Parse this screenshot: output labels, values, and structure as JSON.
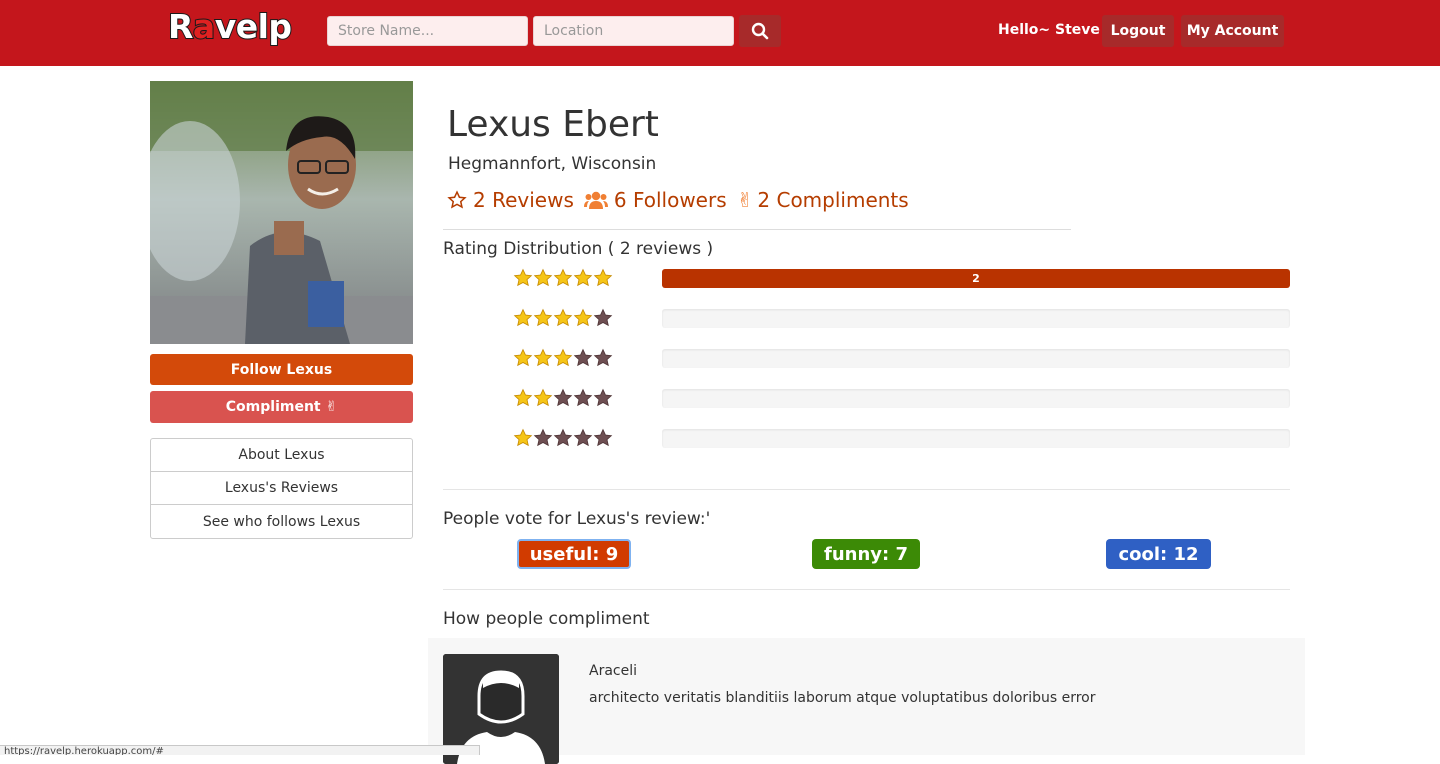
{
  "header": {
    "logo": "Ravelp",
    "store_placeholder": "Store Name...",
    "location_placeholder": "Location",
    "search_icon": "search-icon",
    "greeting": "Hello~ Steve",
    "logout_label": "Logout",
    "account_label": "My Account",
    "brand_color": "#c4161c"
  },
  "sidebar": {
    "follow_label": "Follow Lexus",
    "compliment_label": "Compliment ✌",
    "menu": [
      {
        "label": "About Lexus"
      },
      {
        "label": "Lexus's Reviews"
      },
      {
        "label": "See who follows Lexus"
      }
    ]
  },
  "profile": {
    "name": "Lexus Ebert",
    "location": "Hegmannfort, Wisconsin",
    "reviews": "2 Reviews",
    "followers": "6 Followers",
    "compliments": "2 Compliments"
  },
  "rating_distribution": {
    "title": "Rating Distribution ( 2 reviews )",
    "rows": [
      {
        "stars": 5,
        "count": 2,
        "fraction": 1.0,
        "label": "2"
      },
      {
        "stars": 4,
        "count": 0,
        "fraction": 0,
        "label": ""
      },
      {
        "stars": 3,
        "count": 0,
        "fraction": 0,
        "label": ""
      },
      {
        "stars": 2,
        "count": 0,
        "fraction": 0,
        "label": ""
      },
      {
        "stars": 1,
        "count": 0,
        "fraction": 0,
        "label": ""
      }
    ]
  },
  "votes": {
    "title": "People vote for Lexus's review:'",
    "useful": "useful: 9",
    "funny": "funny: 7",
    "cool": "cool: 12",
    "useful_color": "#d13b00",
    "funny_color": "#3c8a06",
    "cool_color": "#2f60c4"
  },
  "compliments_section": {
    "title": "How people compliment",
    "items": [
      {
        "name": "Araceli",
        "text": "architecto veritatis blanditiis laborum atque voluptatibus doloribus error"
      }
    ]
  },
  "status_bar": {
    "url": "https://ravelp.herokuapp.com/#"
  }
}
